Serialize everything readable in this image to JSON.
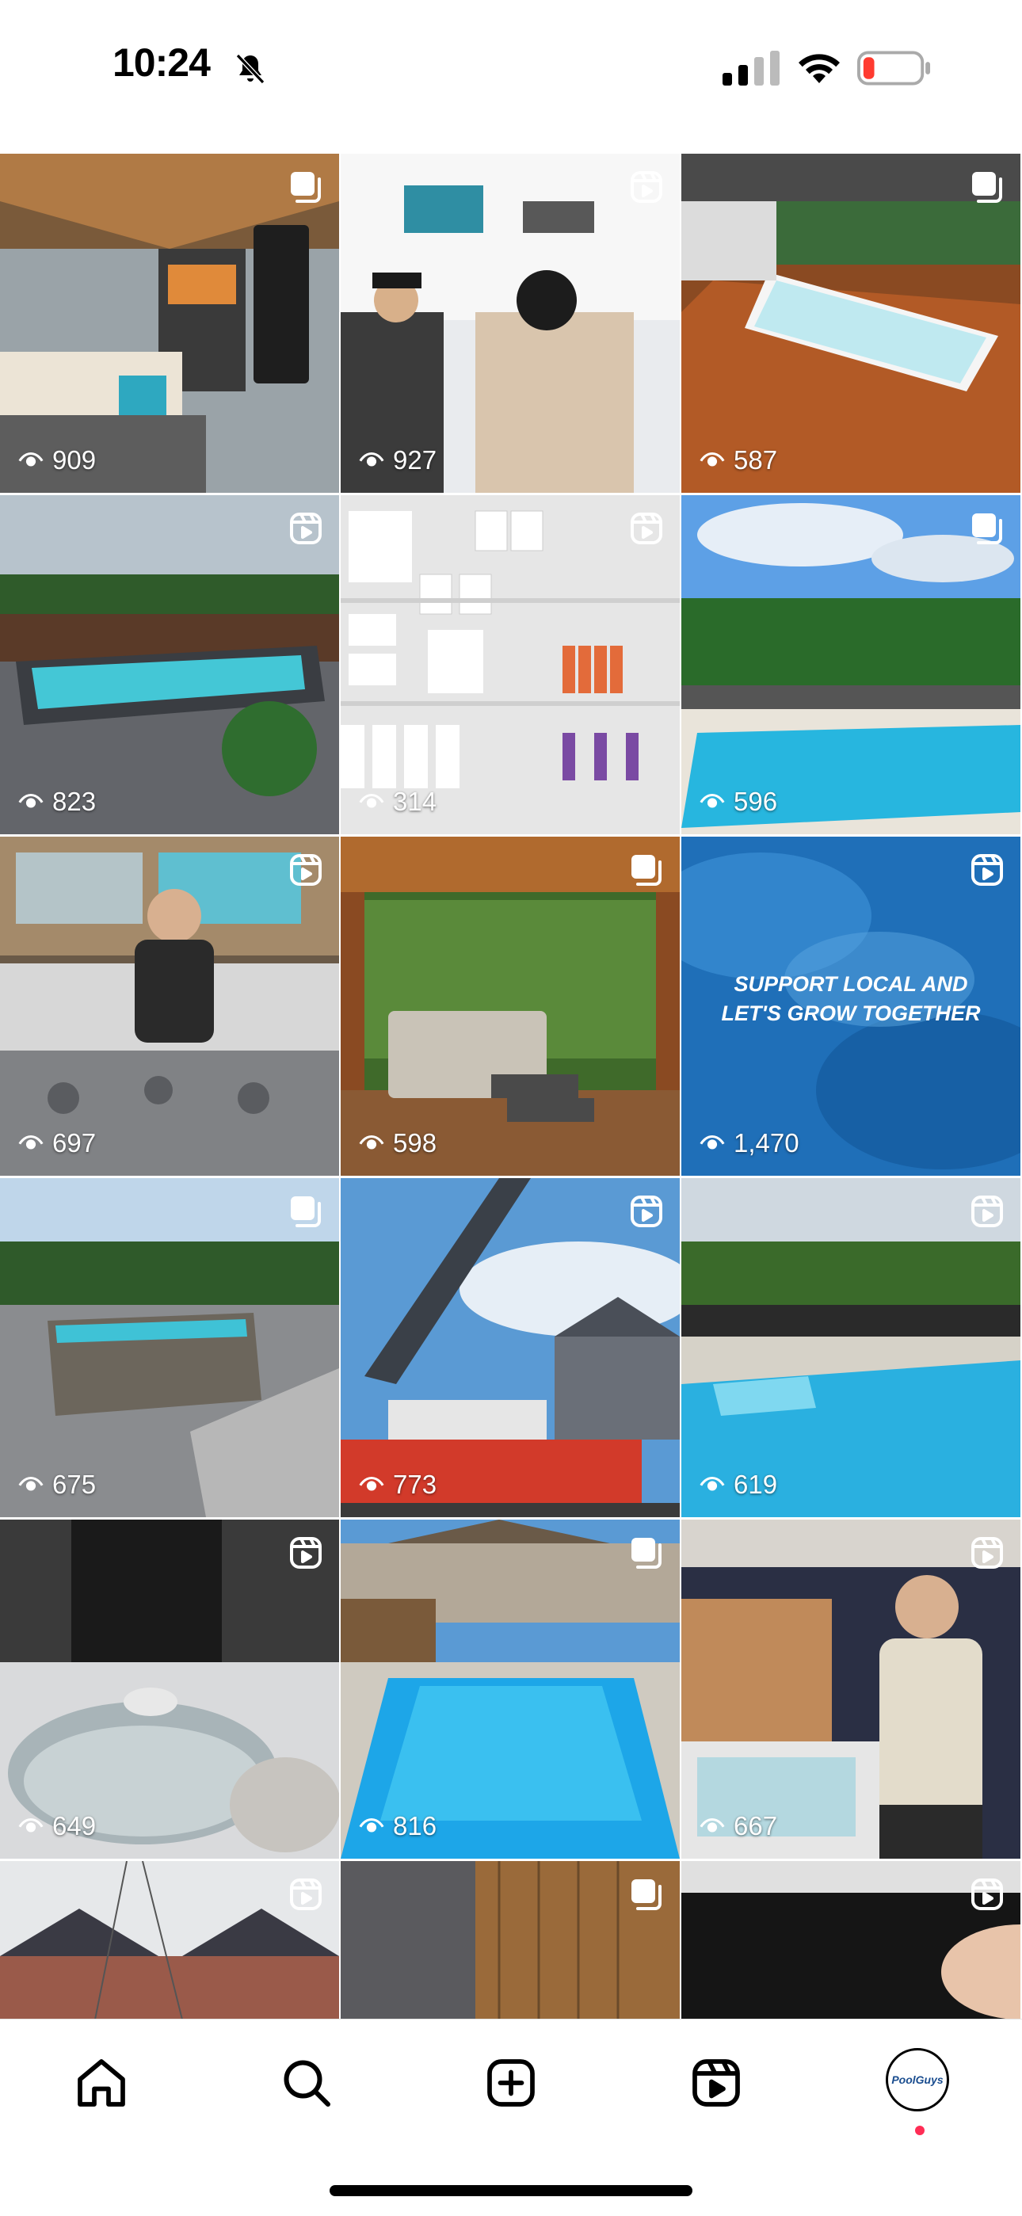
{
  "status_bar": {
    "time": "10:24",
    "icons": [
      "bell-slash-icon",
      "cellular-signal-icon",
      "wifi-icon",
      "battery-low-icon"
    ]
  },
  "grid": {
    "posts": [
      {
        "views": "909",
        "type": "carousel",
        "alt_icon": "carousel-icon"
      },
      {
        "views": "927",
        "type": "reel",
        "alt_icon": "reel-icon"
      },
      {
        "views": "587",
        "type": "carousel",
        "alt_icon": "carousel-icon"
      },
      {
        "views": "823",
        "type": "reel",
        "alt_icon": "reel-icon"
      },
      {
        "views": "314",
        "type": "reel",
        "alt_icon": "reel-icon"
      },
      {
        "views": "596",
        "type": "carousel",
        "alt_icon": "carousel-icon"
      },
      {
        "views": "697",
        "type": "reel",
        "alt_icon": "reel-icon"
      },
      {
        "views": "598",
        "type": "carousel",
        "alt_icon": "carousel-icon"
      },
      {
        "views": "1,470",
        "type": "reel",
        "alt_icon": "reel-icon",
        "overlay": "SUPPORT LOCAL AND\nLET'S GROW TOGETHER"
      },
      {
        "views": "675",
        "type": "carousel",
        "alt_icon": "carousel-icon"
      },
      {
        "views": "773",
        "type": "reel",
        "alt_icon": "reel-icon"
      },
      {
        "views": "619",
        "type": "reel",
        "alt_icon": "reel-icon"
      },
      {
        "views": "649",
        "type": "reel",
        "alt_icon": "reel-icon"
      },
      {
        "views": "816",
        "type": "carousel",
        "alt_icon": "carousel-icon"
      },
      {
        "views": "667",
        "type": "reel",
        "alt_icon": "reel-icon"
      },
      {
        "views": "",
        "type": "reel",
        "alt_icon": "reel-icon"
      },
      {
        "views": "",
        "type": "carousel",
        "alt_icon": "carousel-icon"
      },
      {
        "views": "",
        "type": "reel",
        "alt_icon": "reel-icon"
      }
    ],
    "overlay_line1": "SUPPORT LOCAL AND",
    "overlay_line2": "LET'S GROW TOGETHER"
  },
  "tab_bar": {
    "tabs": [
      {
        "name": "home",
        "icon": "home-icon"
      },
      {
        "name": "search",
        "icon": "search-icon"
      },
      {
        "name": "create",
        "icon": "plus-square-icon"
      },
      {
        "name": "reels",
        "icon": "reels-icon"
      },
      {
        "name": "profile",
        "icon": "profile-avatar"
      }
    ],
    "avatar_text": "PoolGuys",
    "notification_color": "#ff2d55"
  }
}
